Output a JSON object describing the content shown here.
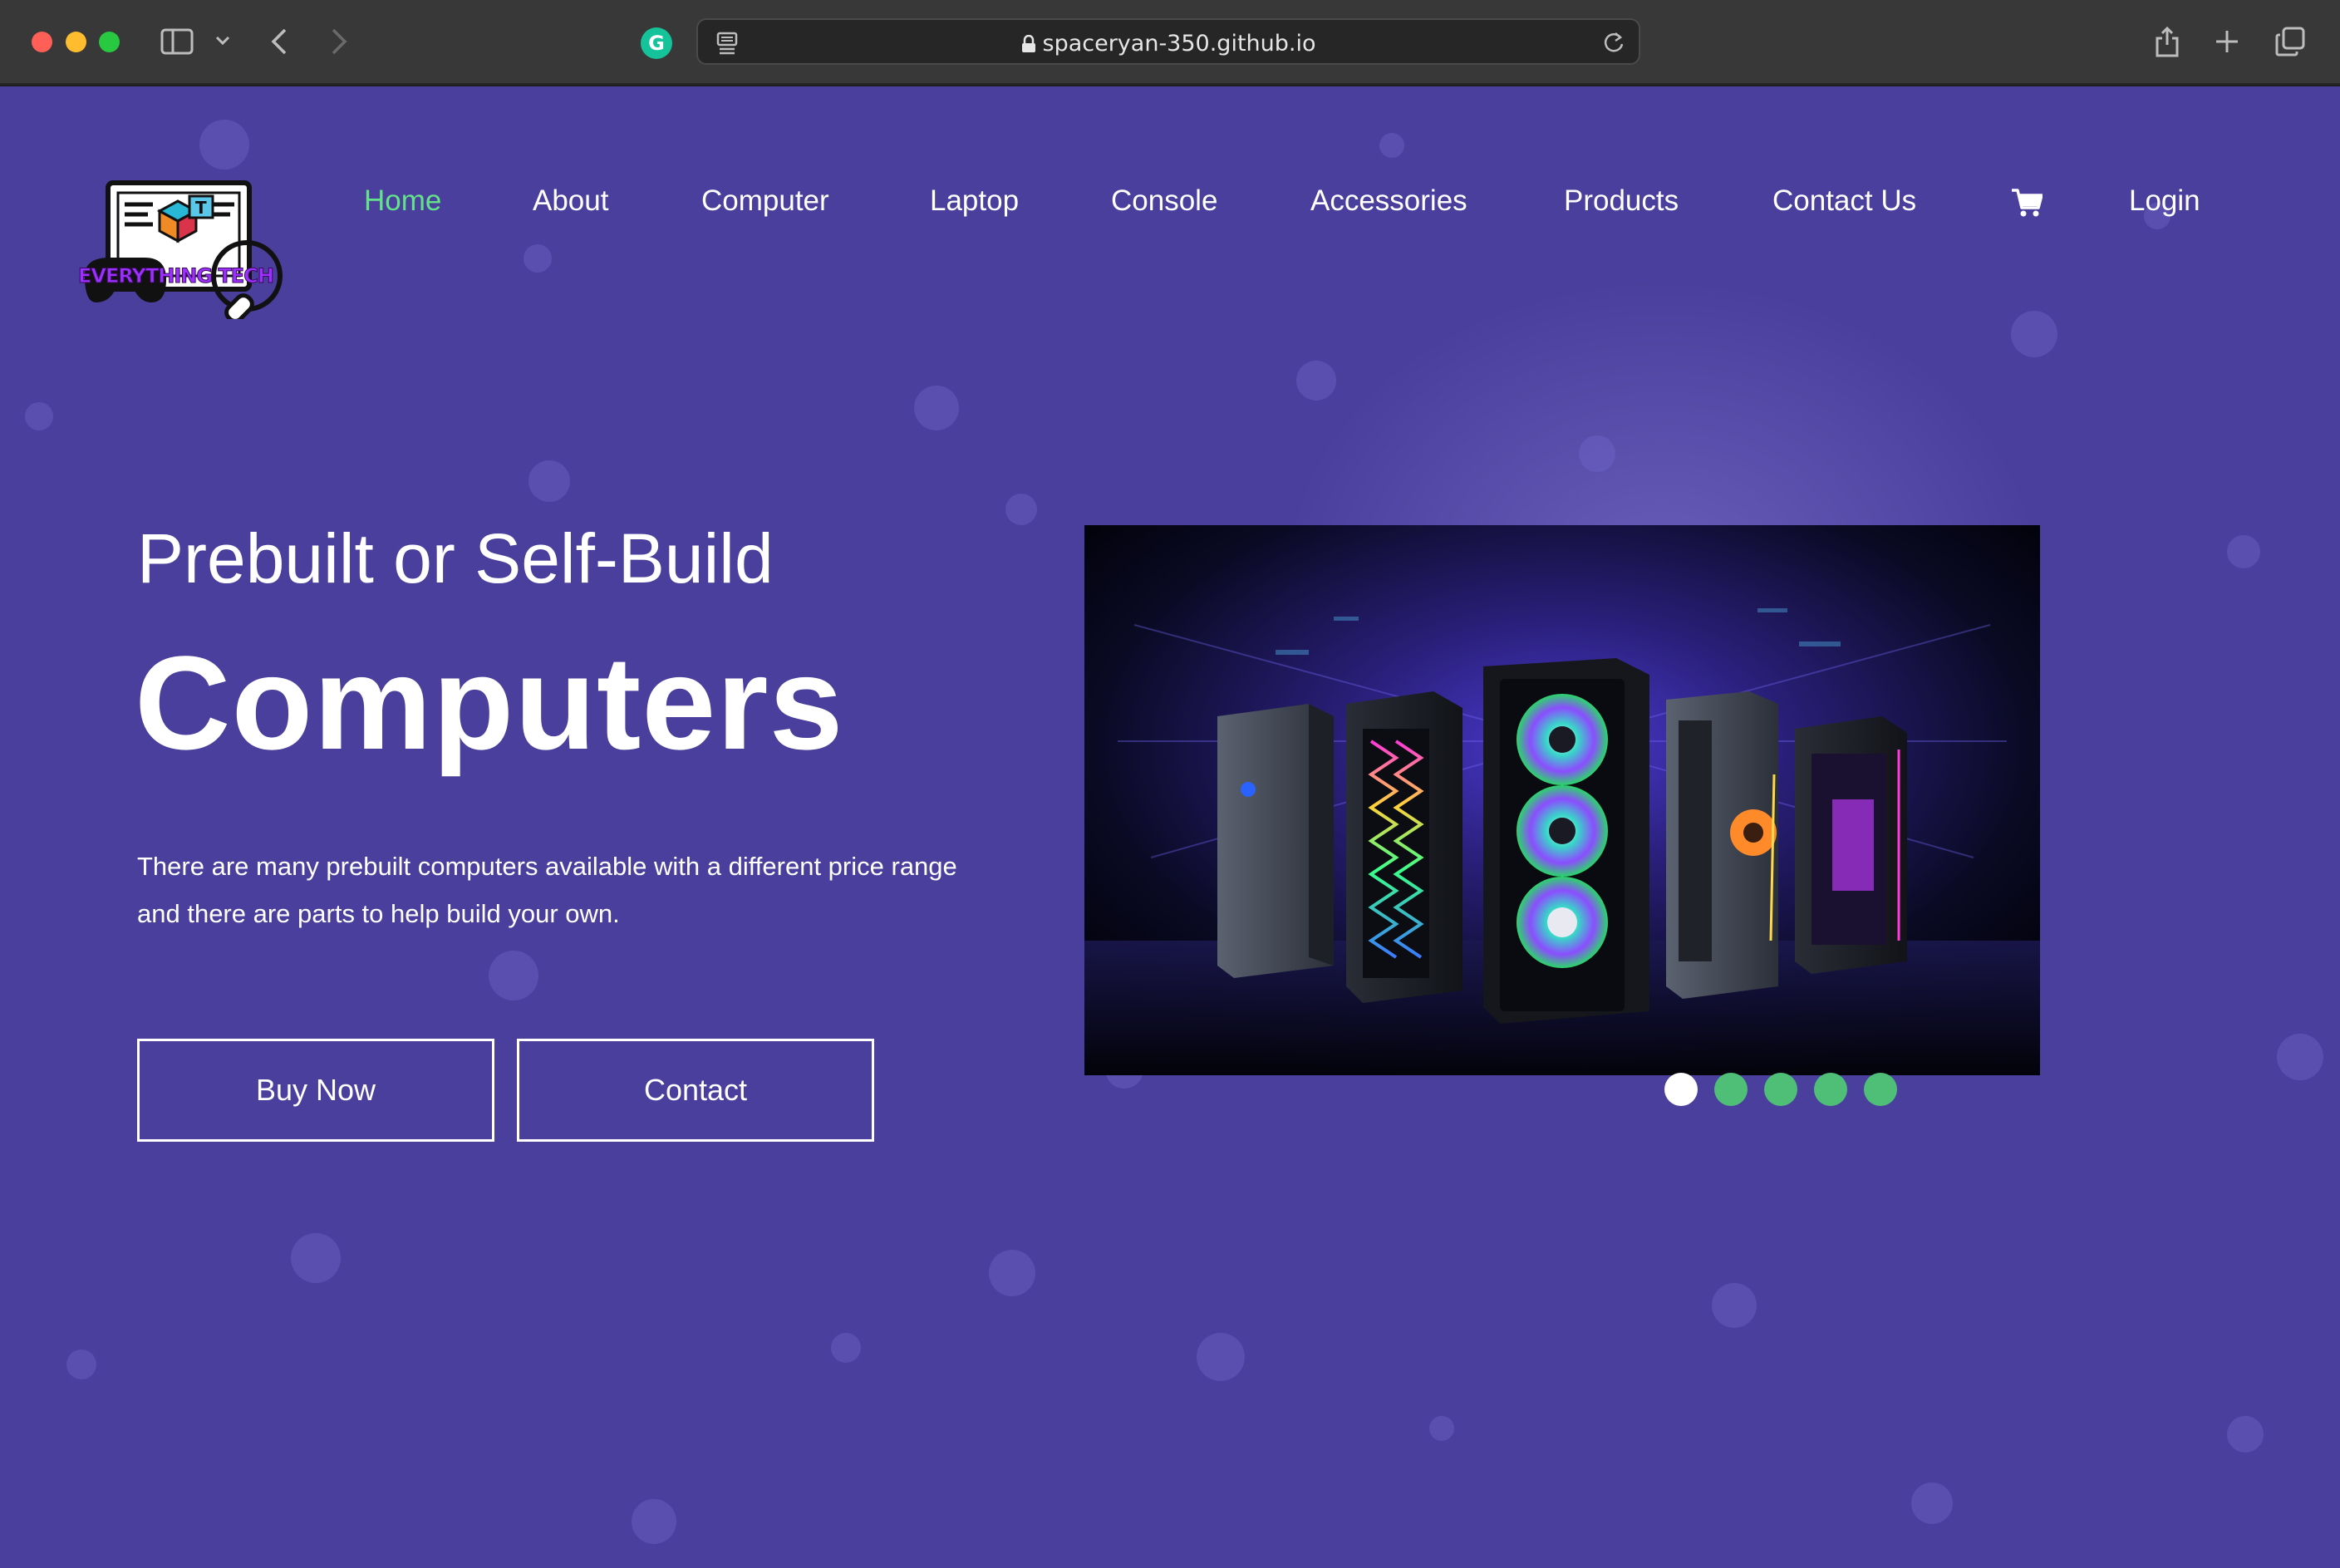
{
  "browser": {
    "url": "spaceryan-350.github.io",
    "grammarly_letter": "G"
  },
  "logo": {
    "text": "EVERYTHING TECH"
  },
  "nav": {
    "items": [
      {
        "label": "Home",
        "active": true
      },
      {
        "label": "About"
      },
      {
        "label": "Computer"
      },
      {
        "label": "Laptop"
      },
      {
        "label": "Console"
      },
      {
        "label": "Accessories"
      },
      {
        "label": "Products"
      },
      {
        "label": "Contact Us"
      }
    ],
    "cart_icon": "cart-icon",
    "login": "Login",
    "active_color": "#63e28a"
  },
  "hero": {
    "subtitle": "Prebuilt or Self-Build",
    "title": "Computers",
    "description": "There are many prebuilt computers available with a different price range and there are parts to help build your own.",
    "buttons": {
      "buy": "Buy Now",
      "contact": "Contact"
    }
  },
  "carousel": {
    "slide_count": 5,
    "active_index": 0,
    "dot_color": "#4fbf78",
    "active_dot_color": "#ffffff"
  },
  "colors": {
    "background": "#4a3f9c",
    "text": "#ffffff"
  }
}
